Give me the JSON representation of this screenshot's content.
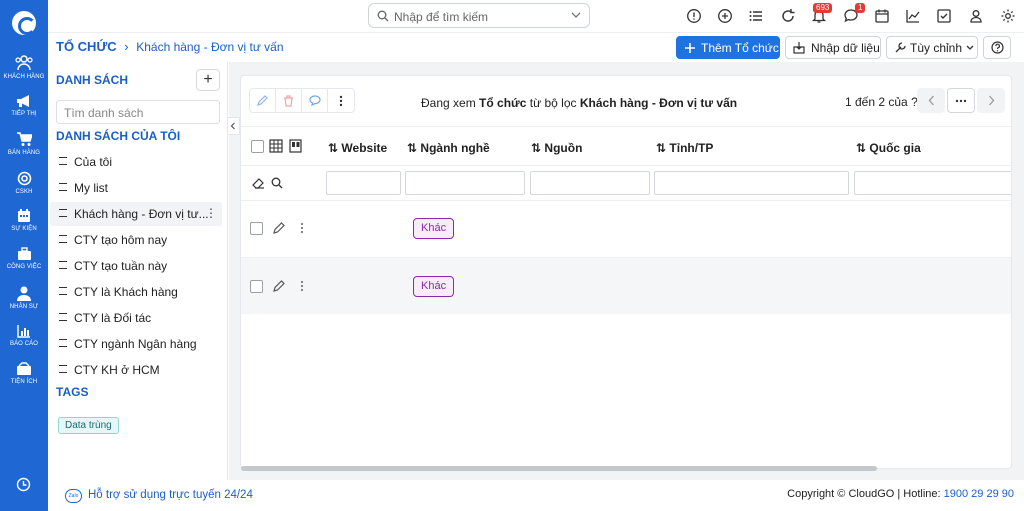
{
  "rail": {
    "items": [
      {
        "label": "KHÁCH HÀNG",
        "icon": "users-icon"
      },
      {
        "label": "TIẾP THỊ",
        "icon": "megaphone-icon"
      },
      {
        "label": "BÁN HÀNG",
        "icon": "cart-icon"
      },
      {
        "label": "CSKH",
        "icon": "lifebuoy-icon"
      },
      {
        "label": "SỰ KIỆN",
        "icon": "calendar-icon"
      },
      {
        "label": "CÔNG VIỆC",
        "icon": "briefcase-icon"
      },
      {
        "label": "NHÂN SỰ",
        "icon": "person-icon"
      },
      {
        "label": "BÁO CÁO",
        "icon": "report-icon"
      },
      {
        "label": "TIỆN ÍCH",
        "icon": "utilities-icon"
      }
    ]
  },
  "topbar": {
    "search_placeholder": "Nhập để tìm kiếm",
    "notification_count": "693",
    "message_count": "1"
  },
  "breadcrumb": {
    "root": "TỔ CHỨC",
    "separator": "›",
    "current": "Khách hàng - Đơn vị tư vấn"
  },
  "actions": {
    "add_label": "Thêm Tổ chức",
    "import_label": "Nhập dữ liệu",
    "options_label": "Tùy chỉnh"
  },
  "sidebar": {
    "title": "DANH SÁCH",
    "search_placeholder": "Tìm danh sách",
    "my_lists_title": "DANH SÁCH CỦA TÔI",
    "items": [
      {
        "label": "Của tôi"
      },
      {
        "label": "My list"
      },
      {
        "label": "Khách hàng - Đơn vị tư...",
        "active": true
      },
      {
        "label": "CTY tạo hôm nay"
      },
      {
        "label": "CTY tạo tuần này"
      },
      {
        "label": "CTY là Khách hàng"
      },
      {
        "label": "CTY là Đối tác"
      },
      {
        "label": "CTY ngành Ngân hàng"
      },
      {
        "label": "CTY KH ở HCM"
      }
    ],
    "tags_title": "TAGS",
    "tags": [
      "Data trùng"
    ]
  },
  "table": {
    "view_prefix": "Đang xem",
    "view_module": "Tổ chức",
    "view_middle": "từ bộ lọc",
    "view_filter": "Khách hàng - Đơn vị tư vấn",
    "pagination": "1 đến 2 của",
    "pagination_unknown": "?",
    "columns": [
      "Website",
      "Ngành nghề",
      "Nguồn",
      "Tỉnh/TP",
      "Quốc gia"
    ],
    "rows": [
      {
        "website": "",
        "industry": "Khác",
        "source": "",
        "province": "",
        "country": ""
      },
      {
        "website": "",
        "industry": "Khác",
        "source": "",
        "province": "",
        "country": ""
      }
    ]
  },
  "footer": {
    "zalo": "Zalo",
    "support": "Hỗ trợ sử dụng trực tuyến 24/24",
    "copyright": "Copyright © CloudGO | Hotline:",
    "hotline": "1900 29 29 90"
  },
  "colors": {
    "brand": "#1f67d2",
    "accent": "#1f73e0",
    "tag_purple": "#8b2aa6"
  }
}
